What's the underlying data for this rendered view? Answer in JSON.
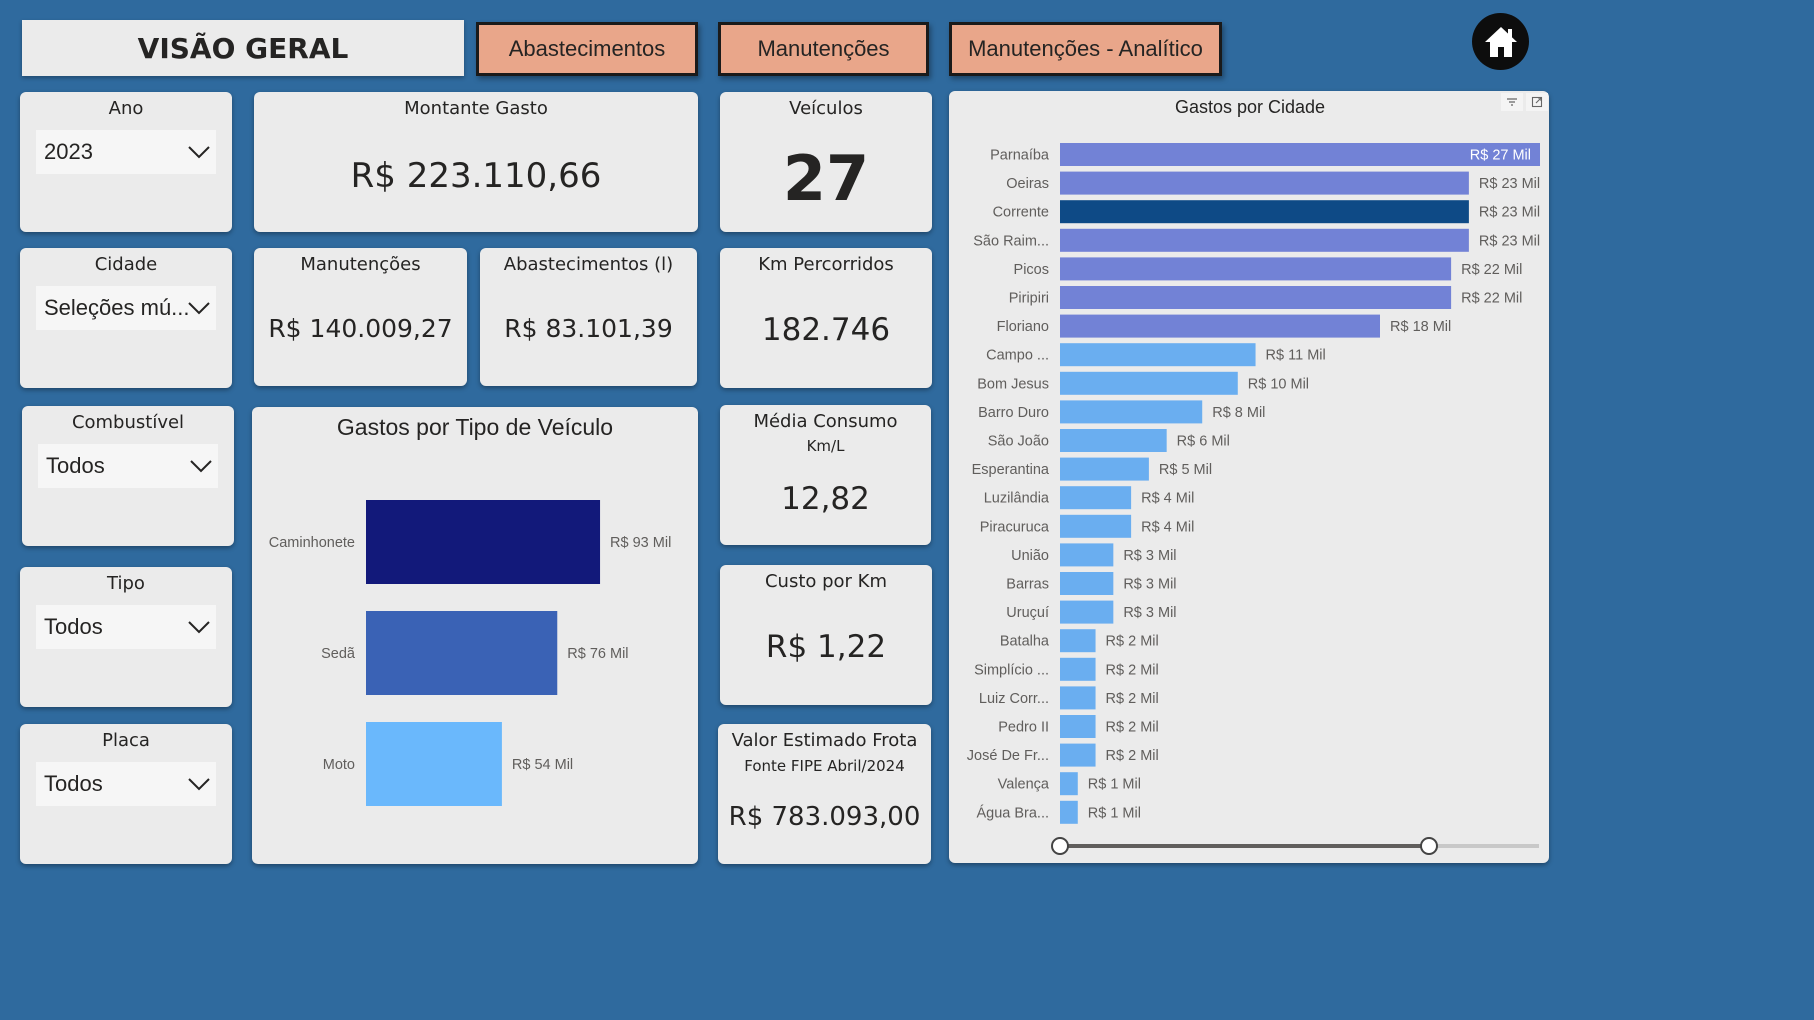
{
  "header": {
    "title": "VISÃO GERAL",
    "nav": [
      "Abastecimentos",
      "Manutenções",
      "Manutenções - Analítico"
    ],
    "home_icon": "home-icon"
  },
  "slicers": {
    "ano": {
      "label": "Ano",
      "value": "2023"
    },
    "cidade": {
      "label": "Cidade",
      "value": "Seleções mú..."
    },
    "combustivel": {
      "label": "Combustível",
      "value": "Todos"
    },
    "tipo": {
      "label": "Tipo",
      "value": "Todos"
    },
    "placa": {
      "label": "Placa",
      "value": "Todos"
    }
  },
  "kpis": {
    "montante": {
      "label": "Montante Gasto",
      "value": "R$ 223.110,66"
    },
    "manutencoes": {
      "label": "Manutenções",
      "value": "R$ 140.009,27"
    },
    "abastecimentos": {
      "label": "Abastecimentos (l)",
      "value": "R$ 83.101,39"
    },
    "veiculos": {
      "label": "Veículos",
      "value": "27"
    },
    "km": {
      "label": "Km Percorridos",
      "value": "182.746"
    },
    "media": {
      "label": "Média Consumo",
      "sub": "Km/L",
      "value": "12,82"
    },
    "custo": {
      "label": "Custo por Km",
      "value": "R$ 1,22"
    },
    "frota": {
      "label": "Valor Estimado Frota",
      "sub": "Fonte FIPE Abril/2024",
      "value": "R$ 783.093,00"
    }
  },
  "chart_data": [
    {
      "type": "bar",
      "orientation": "horizontal",
      "title": "Gastos por Tipo de Veículo",
      "categories": [
        "Caminhonete",
        "Sedã",
        "Moto"
      ],
      "values": [
        93,
        76,
        54
      ],
      "labels": [
        "R$ 93 Mil",
        "R$ 76 Mil",
        "R$ 54 Mil"
      ],
      "colors": [
        "#12197a",
        "#3a62b5",
        "#6ab8fc"
      ],
      "xlim": [
        0,
        120
      ]
    },
    {
      "type": "bar",
      "orientation": "horizontal",
      "title": "Gastos por Cidade",
      "categories": [
        "Parnaíba",
        "Oeiras",
        "Corrente",
        "São Raim...",
        "Picos",
        "Piripiri",
        "Floriano",
        "Campo ...",
        "Bom Jesus",
        "Barro Duro",
        "São João",
        "Esperantina",
        "Luzilândia",
        "Piracuruca",
        "União",
        "Barras",
        "Uruçuí",
        "Batalha",
        "Simplício ...",
        "Luiz Corr...",
        "Pedro II",
        "José De Fr...",
        "Valença",
        "Água Bra..."
      ],
      "values": [
        27,
        23,
        23,
        23,
        22,
        22,
        18,
        11,
        10,
        8,
        6,
        5,
        4,
        4,
        3,
        3,
        3,
        2,
        2,
        2,
        2,
        2,
        1,
        1
      ],
      "labels": [
        "R$ 27 Mil",
        "R$ 23 Mil",
        "R$ 23 Mil",
        "R$ 23 Mil",
        "R$ 22 Mil",
        "R$ 22 Mil",
        "R$ 18 Mil",
        "R$ 11 Mil",
        "R$ 10 Mil",
        "R$ 8 Mil",
        "R$ 6 Mil",
        "R$ 5 Mil",
        "R$ 4 Mil",
        "R$ 4 Mil",
        "R$ 3 Mil",
        "R$ 3 Mil",
        "R$ 3 Mil",
        "R$ 2 Mil",
        "R$ 2 Mil",
        "R$ 2 Mil",
        "R$ 2 Mil",
        "R$ 2 Mil",
        "R$ 1 Mil",
        "R$ 1 Mil"
      ],
      "highlight": "Corrente",
      "colors": {
        "high": "#7282d6",
        "highlight": "#0e4a86",
        "low": "#6aaef0"
      },
      "xlim": [
        0,
        27
      ]
    }
  ]
}
